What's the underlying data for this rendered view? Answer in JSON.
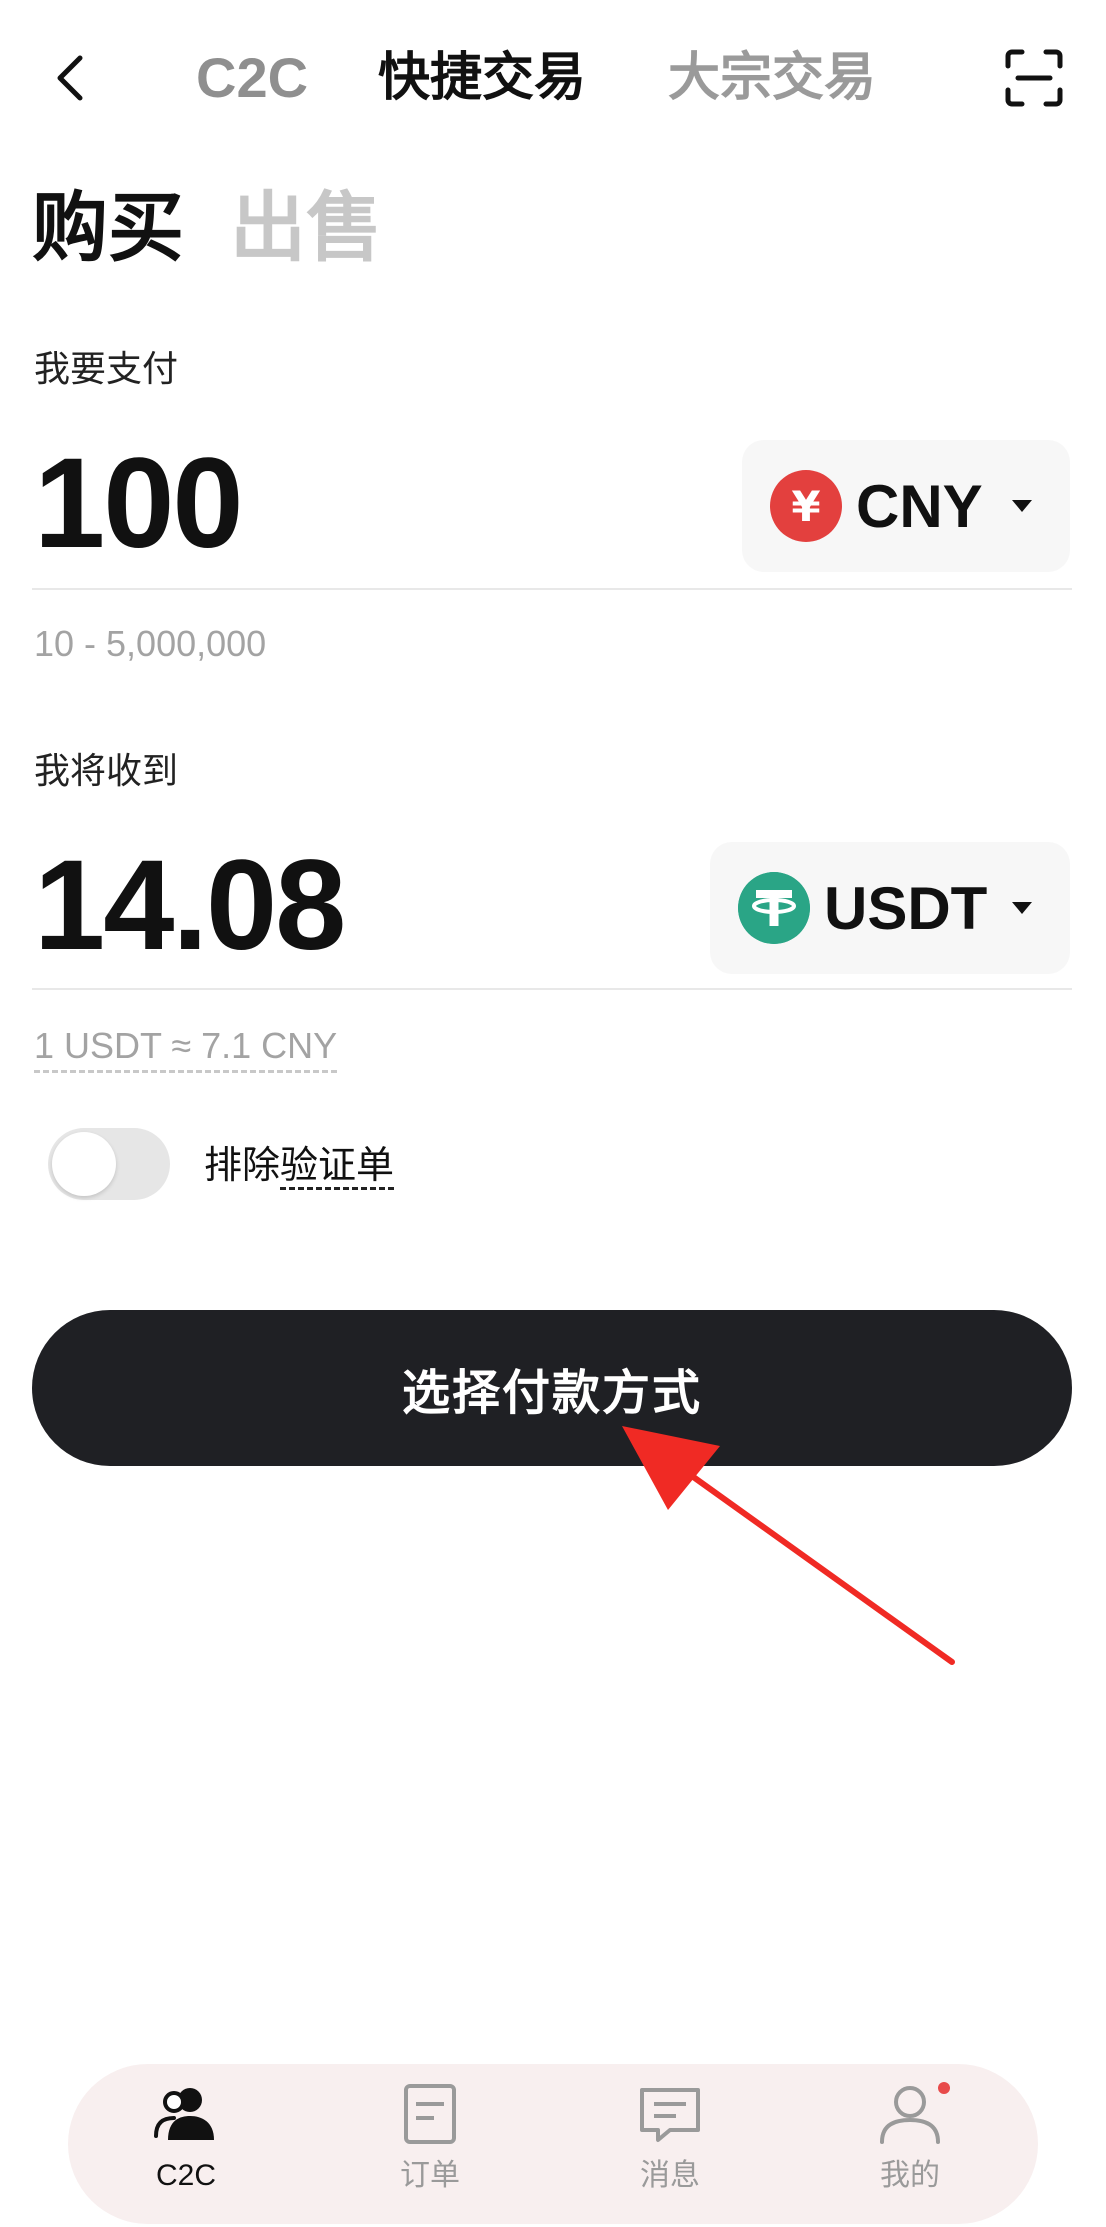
{
  "top_nav": {
    "tabs": [
      "C2C",
      "快捷交易",
      "大宗交易"
    ],
    "active_tab": "快捷交易"
  },
  "mode_tabs": {
    "buy": "购买",
    "sell": "出售",
    "active": "购买"
  },
  "pay": {
    "label": "我要支付",
    "amount": "100",
    "currency": "CNY",
    "currency_symbol": "¥",
    "range": "10 - 5,000,000"
  },
  "receive": {
    "label": "我将收到",
    "amount": "14.08",
    "currency": "USDT",
    "rate": "1 USDT ≈ 7.1 CNY"
  },
  "exclude_verified": {
    "label_prefix": "排除",
    "label_dashed": "验证单",
    "on": false
  },
  "action_button": {
    "label": "选择付款方式"
  },
  "bottom_nav": {
    "items": [
      {
        "label": "C2C",
        "icon": "users-icon",
        "active": true
      },
      {
        "label": "订单",
        "icon": "order-icon",
        "active": false
      },
      {
        "label": "消息",
        "icon": "message-icon",
        "active": false
      },
      {
        "label": "我的",
        "icon": "profile-icon",
        "active": false,
        "badge": true
      }
    ]
  },
  "colors": {
    "accent_dark": "#1f2024",
    "cny_coin": "#e3403e",
    "usdt_coin": "#2aa586",
    "annotation_arrow": "#f02a24",
    "bottom_nav_bg": "#f8efef"
  }
}
